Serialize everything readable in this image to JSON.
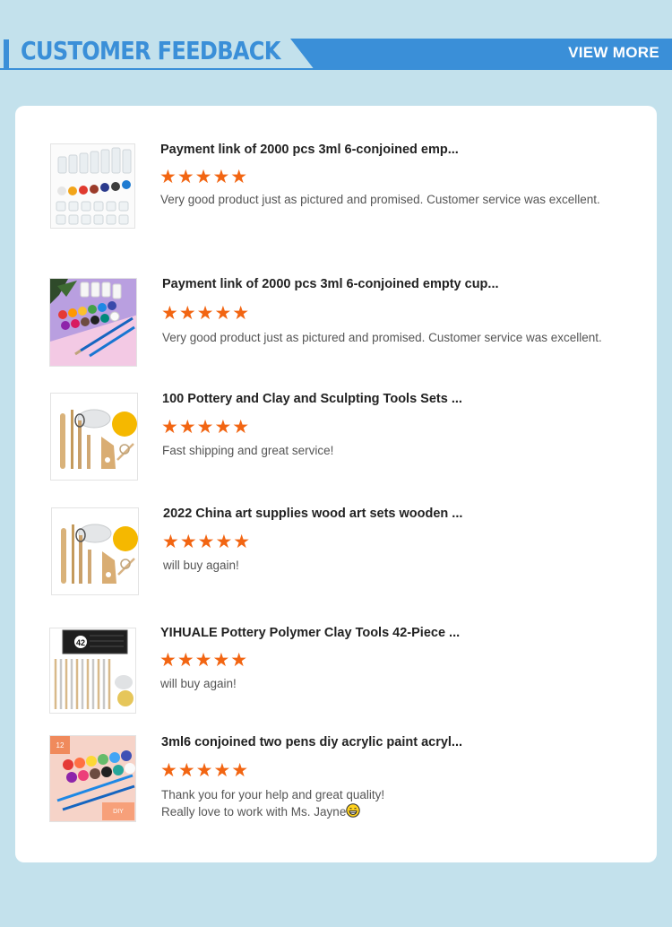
{
  "header": {
    "title": "CUSTOMER FEEDBACK",
    "view_more": "VIEW  MORE",
    "accent_color": "#3a8fd8"
  },
  "reviews": [
    {
      "title": "Payment link of 2000 pcs 3ml 6-conjoined emp...",
      "stars": "★★★★★",
      "rating": 5,
      "text": "Very good product just as pictured and promised. Customer service was excellent.",
      "image": "empty-paint-cups"
    },
    {
      "title": "Payment link of 2000 pcs 3ml 6-conjoined empty cup...",
      "stars": "★★★★★",
      "rating": 5,
      "text": "Very good product just as pictured and promised. Customer service was excellent.",
      "image": "paint-cups-pink"
    },
    {
      "title": "100 Pottery and Clay and Sculpting Tools Sets ...",
      "stars": "★★★★★",
      "rating": 5,
      "text": "Fast shipping and great service!",
      "image": "pottery-tools"
    },
    {
      "title": "2022 China art supplies wood art sets wooden ...",
      "stars": "★★★★★",
      "rating": 5,
      "text": "will buy again!",
      "image": "pottery-tools"
    },
    {
      "title": "YIHUALE Pottery Polymer Clay Tools 42-Piece ...",
      "stars": "★★★★★",
      "rating": 5,
      "text": "will buy again!",
      "image": "clay-tools-kit",
      "kit_badge": "42"
    },
    {
      "title": "3ml6 conjoined two pens diy acrylic paint acryl...",
      "stars": "★★★★★",
      "rating": 5,
      "text_line1": "Thank you for your help and great quality!",
      "text_line2": "Really love to work with Ms. Jayne",
      "emoji": "grinning-face-icon",
      "image": "acrylic-paint-set",
      "box_number": "12",
      "box_label": "DIY"
    }
  ],
  "colors": {
    "background": "#c3e1ec",
    "star": "#f26512",
    "card": "#ffffff"
  }
}
